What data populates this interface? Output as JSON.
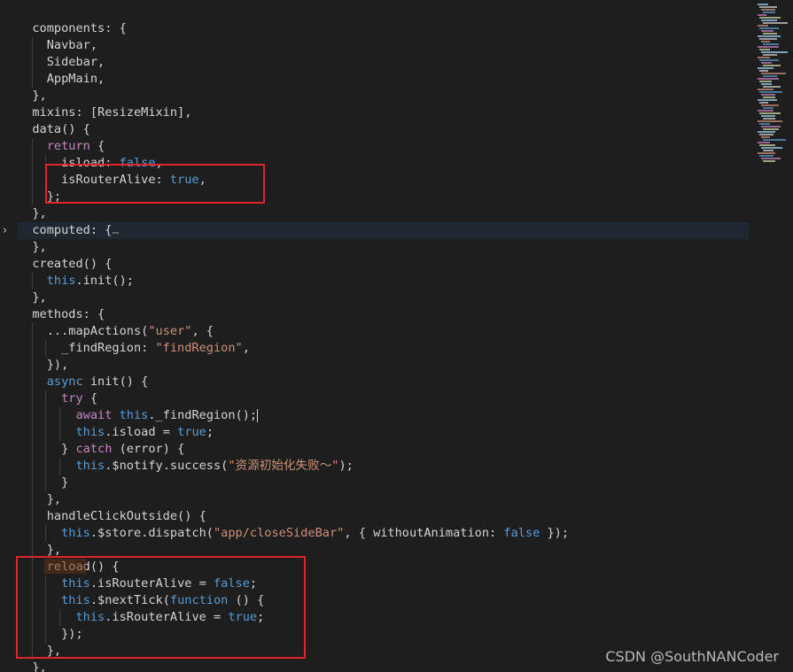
{
  "editor": {
    "lines": [
      [
        [
          "t-plain",
          "  components: {"
        ]
      ],
      [
        [
          "t-plain",
          "    Navbar,"
        ]
      ],
      [
        [
          "t-plain",
          "    Sidebar,"
        ]
      ],
      [
        [
          "t-plain",
          "    AppMain,"
        ]
      ],
      [
        [
          "t-plain",
          "  },"
        ]
      ],
      [
        [
          "t-plain",
          "  mixins: [ResizeMixin],"
        ]
      ],
      [
        [
          "t-plain",
          "  data() {"
        ]
      ],
      [
        [
          "t-plain",
          "    "
        ],
        [
          "t-control",
          "return"
        ],
        [
          "t-plain",
          " {"
        ]
      ],
      [
        [
          "t-plain",
          "      isload: "
        ],
        [
          "t-bool",
          "false"
        ],
        [
          "t-plain",
          ","
        ]
      ],
      [
        [
          "t-plain",
          "      isRouterAlive: "
        ],
        [
          "t-bool",
          "true"
        ],
        [
          "t-plain",
          ","
        ]
      ],
      [
        [
          "t-plain",
          "    };"
        ]
      ],
      [
        [
          "t-plain",
          "  },"
        ]
      ],
      [
        [
          "t-plain",
          "  computed: {"
        ],
        [
          "t-fold",
          "…"
        ]
      ],
      [
        [
          "t-plain",
          "  },"
        ]
      ],
      [
        [
          "t-plain",
          "  created() {"
        ]
      ],
      [
        [
          "t-plain",
          "    "
        ],
        [
          "t-keyword",
          "this"
        ],
        [
          "t-plain",
          ".init();"
        ]
      ],
      [
        [
          "t-plain",
          "  },"
        ]
      ],
      [
        [
          "t-plain",
          "  methods: {"
        ]
      ],
      [
        [
          "t-plain",
          "    ...mapActions("
        ],
        [
          "t-string",
          "\"user\""
        ],
        [
          "t-plain",
          ", {"
        ]
      ],
      [
        [
          "t-plain",
          "      _findRegion: "
        ],
        [
          "t-string",
          "\"findRegion\""
        ],
        [
          "t-plain",
          ","
        ]
      ],
      [
        [
          "t-plain",
          "    }),"
        ]
      ],
      [
        [
          "t-plain",
          "    "
        ],
        [
          "t-keyword",
          "async"
        ],
        [
          "t-plain",
          " init() {"
        ]
      ],
      [
        [
          "t-plain",
          "      "
        ],
        [
          "t-control",
          "try"
        ],
        [
          "t-plain",
          " {"
        ]
      ],
      [
        [
          "t-plain",
          "        "
        ],
        [
          "t-control",
          "await"
        ],
        [
          "t-plain",
          " "
        ],
        [
          "t-keyword",
          "this"
        ],
        [
          "t-plain",
          "._findRegion();"
        ]
      ],
      [
        [
          "t-plain",
          "        "
        ],
        [
          "t-keyword",
          "this"
        ],
        [
          "t-plain",
          ".isload = "
        ],
        [
          "t-bool",
          "true"
        ],
        [
          "t-plain",
          ";"
        ]
      ],
      [
        [
          "t-plain",
          "      } "
        ],
        [
          "t-control",
          "catch"
        ],
        [
          "t-plain",
          " (error) {"
        ]
      ],
      [
        [
          "t-plain",
          "        "
        ],
        [
          "t-keyword",
          "this"
        ],
        [
          "t-plain",
          ".$notify.success("
        ],
        [
          "t-string",
          "\"资源初始化失败～\""
        ],
        [
          "t-plain",
          ");"
        ]
      ],
      [
        [
          "t-plain",
          "      }"
        ]
      ],
      [
        [
          "t-plain",
          "    },"
        ]
      ],
      [
        [
          "t-plain",
          "    handleClickOutside() {"
        ]
      ],
      [
        [
          "t-plain",
          "      "
        ],
        [
          "t-keyword",
          "this"
        ],
        [
          "t-plain",
          ".$store.dispatch("
        ],
        [
          "t-string",
          "\"app/closeSideBar\""
        ],
        [
          "t-plain",
          ", { withoutAnimation: "
        ],
        [
          "t-bool",
          "false"
        ],
        [
          "t-plain",
          " });"
        ]
      ],
      [
        [
          "t-plain",
          "    },"
        ]
      ],
      [
        [
          "t-plain",
          "    reload() {"
        ]
      ],
      [
        [
          "t-plain",
          "      "
        ],
        [
          "t-keyword",
          "this"
        ],
        [
          "t-plain",
          ".isRouterAlive = "
        ],
        [
          "t-bool",
          "false"
        ],
        [
          "t-plain",
          ";"
        ]
      ],
      [
        [
          "t-plain",
          "      "
        ],
        [
          "t-keyword",
          "this"
        ],
        [
          "t-plain",
          ".$nextTick("
        ],
        [
          "t-keyword",
          "function"
        ],
        [
          "t-plain",
          " () {"
        ]
      ],
      [
        [
          "t-plain",
          "        "
        ],
        [
          "t-keyword",
          "this"
        ],
        [
          "t-plain",
          ".isRouterAlive = "
        ],
        [
          "t-bool",
          "true"
        ],
        [
          "t-plain",
          ";"
        ]
      ],
      [
        [
          "t-plain",
          "      });"
        ]
      ],
      [
        [
          "t-plain",
          "    },"
        ]
      ],
      [
        [
          "t-plain",
          "  },"
        ]
      ]
    ]
  },
  "fold_marker": "›",
  "watermark": "CSDN @SouthNANCoder",
  "colors": {
    "background": "#1e1e1e",
    "annotation_border": "#e0242c",
    "keyword": "#569cd6",
    "control": "#c586c0",
    "string": "#ce9178"
  }
}
